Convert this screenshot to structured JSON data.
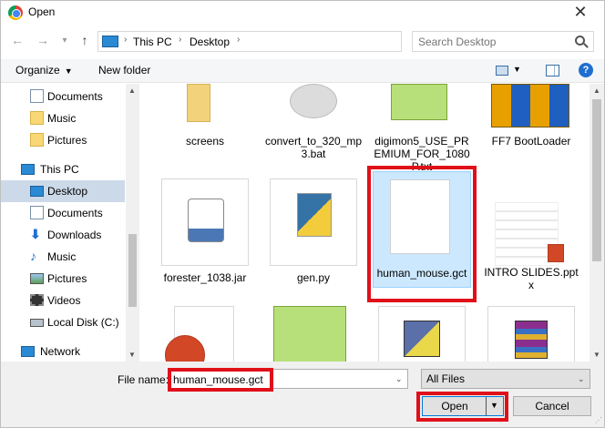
{
  "window": {
    "title": "Open",
    "close_glyph": "✕"
  },
  "nav": {
    "back_glyph": "←",
    "forward_glyph": "→",
    "history_glyph": "▾",
    "up_glyph": "↑",
    "breadcrumb": [
      "This PC",
      "Desktop"
    ],
    "separator_glyph": "›",
    "dropdown_glyph": "⌄",
    "refresh_glyph": "↻",
    "search_placeholder": "Search Desktop"
  },
  "toolbar": {
    "organize_label": "Organize",
    "organize_caret": "▼",
    "new_folder_label": "New folder",
    "view_caret": "▼",
    "help_glyph": "?"
  },
  "sidebar": {
    "items": [
      {
        "label": "Documents",
        "icon": "documents-icon"
      },
      {
        "label": "Music",
        "icon": "folder-icon"
      },
      {
        "label": "Pictures",
        "icon": "folder-icon"
      },
      {
        "label": "This PC",
        "icon": "computer-icon"
      },
      {
        "label": "Desktop",
        "icon": "desktop-icon",
        "selected": true
      },
      {
        "label": "Documents",
        "icon": "documents-icon"
      },
      {
        "label": "Downloads",
        "icon": "download-icon"
      },
      {
        "label": "Music",
        "icon": "music-icon"
      },
      {
        "label": "Pictures",
        "icon": "pictures-icon"
      },
      {
        "label": "Videos",
        "icon": "videos-icon"
      },
      {
        "label": "Local Disk (C:)",
        "icon": "drive-icon"
      },
      {
        "label": "Network",
        "icon": "network-icon"
      }
    ],
    "scroll_up_glyph": "▲",
    "scroll_down_glyph": "▼"
  },
  "files": [
    {
      "label": "screens",
      "icon": "folder-icon"
    },
    {
      "label": "convert_to_320_mp3.bat",
      "icon": "batch-file-icon"
    },
    {
      "label": "digimon5_USE_PREMIUM_FOR_1080P.txt",
      "icon": "notepad-plus-plus-icon"
    },
    {
      "label": "FF7 BootLoader",
      "icon": "shield-shortcut-icon"
    },
    {
      "label": "forester_1038.jar",
      "icon": "java-icon"
    },
    {
      "label": "gen.py",
      "icon": "python-file-icon"
    },
    {
      "label": "human_mouse.gct",
      "icon": "blank-file-icon",
      "selected": true
    },
    {
      "label": "INTRO SLIDES.pptx",
      "icon": "powerpoint-icon"
    },
    {
      "label": "",
      "icon": "powerpoint-icon"
    },
    {
      "label": "",
      "icon": "notepad-plus-plus-icon"
    },
    {
      "label": "",
      "icon": "putty-icon"
    },
    {
      "label": "",
      "icon": "winrar-icon"
    }
  ],
  "bottom": {
    "filename_label": "File name:",
    "filename_value": "human_mouse.gct",
    "filename_caret": "⌄",
    "filetype_value": "All Files",
    "filetype_caret": "⌄",
    "open_label": "Open",
    "open_caret": "▼",
    "cancel_label": "Cancel"
  },
  "colors": {
    "highlight_box": "#e0101a",
    "selection": "#cce8ff",
    "accent": "#0078d7"
  }
}
